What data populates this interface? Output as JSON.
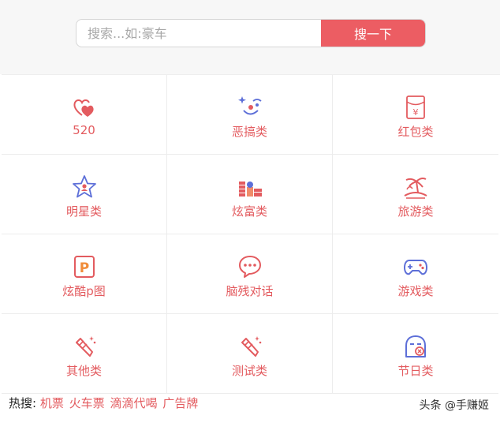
{
  "search": {
    "placeholder": "搜索...如:豪车",
    "button_label": "搜一下"
  },
  "categories": [
    {
      "label": "520",
      "icon": "hearts-icon"
    },
    {
      "label": "恶搞类",
      "icon": "clown-face-icon"
    },
    {
      "label": "红包类",
      "icon": "red-envelope-icon"
    },
    {
      "label": "明星类",
      "icon": "star-person-icon"
    },
    {
      "label": "炫富类",
      "icon": "money-stack-icon"
    },
    {
      "label": "旅游类",
      "icon": "beach-palm-icon"
    },
    {
      "label": "炫酷p图",
      "icon": "p-photo-icon"
    },
    {
      "label": "脑残对话",
      "icon": "chat-bubble-icon"
    },
    {
      "label": "游戏类",
      "icon": "gamepad-icon"
    },
    {
      "label": "其他类",
      "icon": "pen-sparkle-icon"
    },
    {
      "label": "测试类",
      "icon": "pen-sparkle-icon"
    },
    {
      "label": "节日类",
      "icon": "festival-mask-icon"
    }
  ],
  "hot": {
    "prefix": "热搜:",
    "links": [
      "机票",
      "火车票",
      "滴滴代喝",
      "广告牌"
    ]
  },
  "watermark": "头条 @手赚姬",
  "colors": {
    "accent": "#ec5d63",
    "icon_blue": "#5d6fd8",
    "label_red": "#e35b5f"
  }
}
